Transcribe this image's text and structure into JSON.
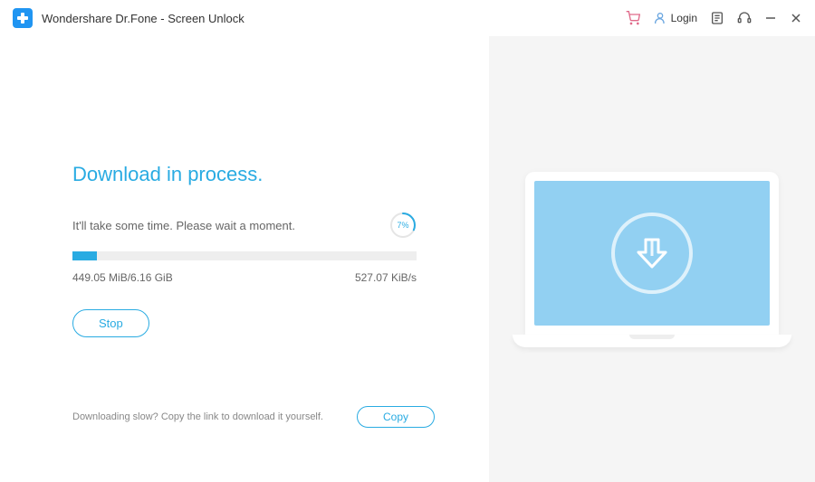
{
  "titlebar": {
    "app_title": "Wondershare Dr.Fone - Screen Unlock",
    "login_label": "Login"
  },
  "main": {
    "heading": "Download in process.",
    "subtext": "It'll take some time. Please wait a moment.",
    "progress_percent_label": "7%",
    "progress_percent_value": 7,
    "downloaded_size": "449.05 MiB/6.16 GiB",
    "download_speed": "527.07 KiB/s",
    "stop_label": "Stop"
  },
  "footer": {
    "slow_text": "Downloading slow? Copy the link to download it yourself.",
    "copy_label": "Copy"
  },
  "colors": {
    "accent": "#29abe2",
    "panel_bg": "#f5f5f5"
  }
}
